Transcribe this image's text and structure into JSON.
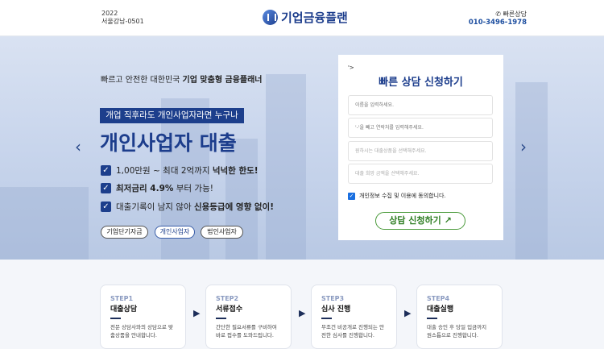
{
  "header": {
    "reg_year": "2022",
    "reg_no": "서울강남-0501",
    "logo": "기업금융플랜",
    "contact_label": "빠른상담",
    "phone": "010-3496-1978"
  },
  "hero": {
    "tagline_pre": "빠르고 안전한 대한민국 ",
    "tagline_bold": "기업 맞춤형 금융플래너",
    "label": "개업 직후라도 개인사업자라면 누구나",
    "title": "개인사업자 대출",
    "checks": [
      {
        "pre": "1,00만원 ~ 최대 2억까지 ",
        "bold": "넉넉한 한도!",
        "post": ""
      },
      {
        "pre": "",
        "bold": "최저금리 4.9%",
        "post": " 부터 가능!"
      },
      {
        "pre": "대출기록이 남지 않아 ",
        "bold": "신용등급에 영향 없이!",
        "post": ""
      }
    ],
    "pills": [
      "기업단기자금",
      "개인사업자",
      "법인사업자"
    ],
    "active_pill": "개인사업자",
    "prev": "‹",
    "next": "›"
  },
  "form": {
    "mark": "'>",
    "title": "빠른 상담 신청하기",
    "placeholders": [
      "이름을 입력하세요.",
      "'-'을 빼고 연락처를 입력해주세요.",
      "원하시는 대출상품을 선택해주세요.",
      "대출 희망 금액을 선택해주세요."
    ],
    "agree": "개인정보 수집 및 이용에 동의합니다.",
    "agree_checked": true,
    "submit": "상담 신청하기 ↗"
  },
  "steps": [
    {
      "num": "STEP1",
      "title": "대출상담",
      "desc": "전문 상담사와의 상담으로 맞춤상품을 안내합니다."
    },
    {
      "num": "STEP2",
      "title": "서류접수",
      "desc": "간단한 필요서류를 구비하여 바로 접수를 도와드립니다."
    },
    {
      "num": "STEP3",
      "title": "심사 진행",
      "desc": "무조건 비공개로 진행되는 안전한 심사를 진행합니다."
    },
    {
      "num": "STEP4",
      "title": "대출실행",
      "desc": "대출 승인 후 당일 입금까지 원스톱으로 진행합니다."
    }
  ],
  "colors": {
    "brand": "#1c3d8c",
    "submit": "#2e7d22"
  }
}
